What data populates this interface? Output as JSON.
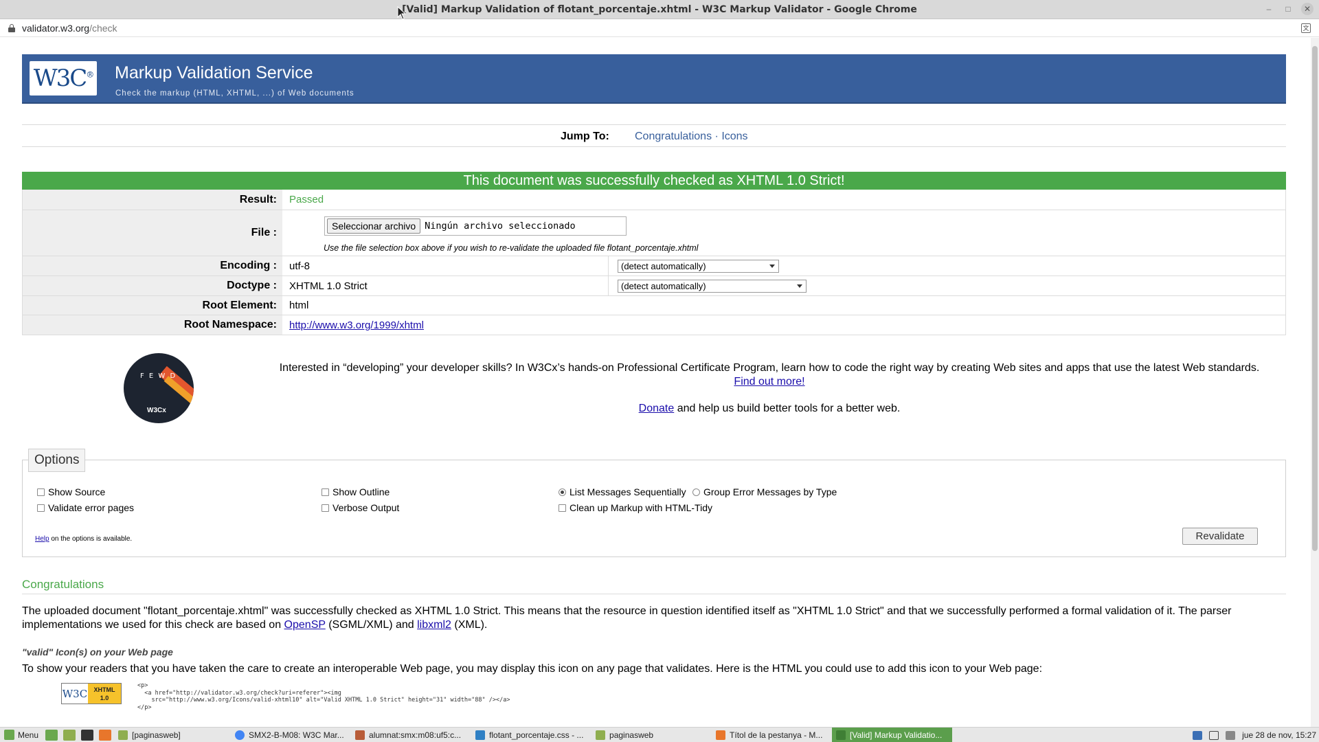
{
  "window": {
    "title": "[Valid] Markup Validation of flotant_porcentaje.xhtml - W3C Markup Validator - Google Chrome",
    "url_host": "validator.w3.org",
    "url_path": "/check"
  },
  "banner": {
    "logo_text": "W3C",
    "logo_reg": "®",
    "title": "Markup Validation Service",
    "subtitle": "Check the markup (HTML, XHTML, ...) of Web documents"
  },
  "jump": {
    "label": "Jump To:",
    "link_congrats": "Congratulations",
    "separator": "·",
    "link_icons": "Icons"
  },
  "result": {
    "banner": "This document was successfully checked as XHTML 1.0 Strict!",
    "result_label": "Result:",
    "result_value": "Passed",
    "file_label": "File :",
    "file_button": "Seleccionar archivo",
    "file_none": "Ningún archivo seleccionado",
    "file_note": "Use the file selection box above if you wish to re-validate the uploaded file flotant_porcentaje.xhtml",
    "encoding_label": "Encoding :",
    "encoding_value": "utf-8",
    "encoding_select": "(detect automatically)",
    "doctype_label": "Doctype :",
    "doctype_value": "XHTML 1.0 Strict",
    "doctype_select": "(detect automatically)",
    "root_label": "Root Element:",
    "root_value": "html",
    "ns_label": "Root Namespace:",
    "ns_value": "http://www.w3.org/1999/xhtml"
  },
  "promo": {
    "badge_letters": "F E W D",
    "badge_brand": "W3Cx",
    "text": "Interested in “developing” your developer skills? In W3Cx’s hands-on Professional Certificate Program, learn how to code the right way by creating Web sites and apps that use the latest Web standards.",
    "link": "Find out more!",
    "donate_link": "Donate",
    "donate_text": " and help us build better tools for a better web."
  },
  "options": {
    "legend": "Options",
    "show_source": "Show Source",
    "show_outline": "Show Outline",
    "list_sequential": "List Messages Sequentially",
    "group_by_type": "Group Error Messages by Type",
    "validate_error_pages": "Validate error pages",
    "verbose_output": "Verbose Output",
    "cleanup_tidy": "Clean up Markup with HTML-Tidy",
    "help_link": "Help",
    "help_text": " on the options is available.",
    "revalidate": "Revalidate"
  },
  "congrats": {
    "heading": "Congratulations",
    "para_1": "The uploaded document \"flotant_porcentaje.xhtml\" was successfully checked as XHTML 1.0 Strict. This means that the resource in question identified itself as \"XHTML 1.0 Strict\" and that we successfully performed a formal validation of it. The parser implementations we used for this check are based on ",
    "opensp": "OpenSP",
    "para_2": " (SGML/XML) and ",
    "libxml2": "libxml2",
    "para_3": " (XML).",
    "icon_heading": "\"valid\" Icon(s) on your Web page",
    "icon_text": "To show your readers that you have taken the care to create an interoperable Web page, you may display this icon on any page that validates. Here is the HTML you could use to add this icon to your Web page:",
    "badge_w3c": "W3C",
    "badge_xhtml": "XHTML",
    "badge_ver": "1.0",
    "code": "<p>\n  <a href=\"http://validator.w3.org/check?uri=referer\"><img\n    src=\"http://www.w3.org/Icons/valid-xhtml10\" alt=\"Valid XHTML 1.0 Strict\" height=\"31\" width=\"88\" /></a>\n</p>"
  },
  "taskbar": {
    "menu": "Menu",
    "items": [
      "[paginasweb]",
      "SMX2-B-M08: W3C Mar...",
      "alumnat:smx:m08:uf5:c...",
      "flotant_porcentaje.css - ...",
      "paginasweb",
      "Títol de la pestanya - M...",
      "[Valid] Markup Validatio..."
    ],
    "clock": "jue 28 de nov, 15:27"
  },
  "colors": {
    "banner_blue": "#385f9c",
    "success_green": "#4aa84a",
    "link_blue": "#1a0dab"
  }
}
